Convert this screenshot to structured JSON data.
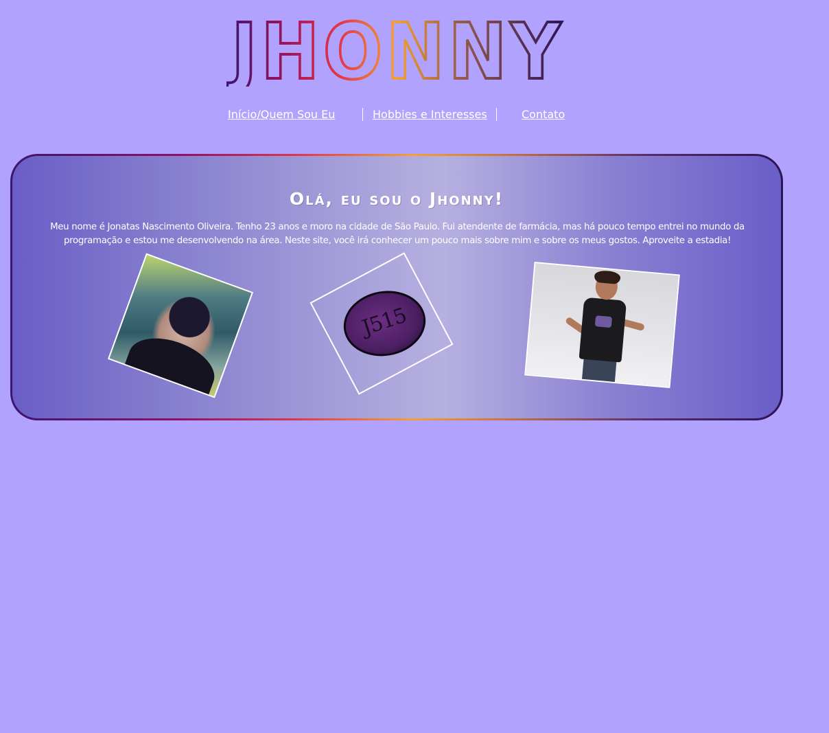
{
  "header": {
    "logo_text": "JHONNY"
  },
  "nav": {
    "items": [
      {
        "label": "Início/Quem Sou Eu"
      },
      {
        "label": "Hobbies e Interesses"
      },
      {
        "label": "Contato"
      }
    ]
  },
  "intro": {
    "title": "Olá, eu sou o Jhonny!",
    "text": "Meu nome é Jonatas Nascimento Oliveira. Tenho 23 anos e moro na cidade de São Paulo. Fui atendente de farmácia, mas há pouco tempo entrei no mundo da programação e estou me desenvolvendo na área. Neste site, você irá conhecer um pouco mais sobre mim e sobre os meus gostos. Aproveite a estadia!"
  },
  "photos": {
    "logo_badge_text": "J515"
  },
  "colors": {
    "background": "#b1a3fd",
    "gradient_start": "#3a1670",
    "gradient_mid": "#f2a136",
    "gradient_end": "#2c1257",
    "text": "#ffffff"
  }
}
